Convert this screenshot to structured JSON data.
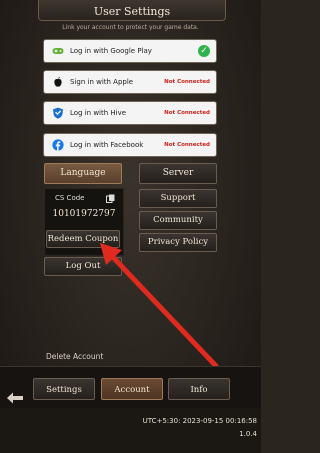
{
  "header": {
    "title": "User Settings",
    "subtitle": "Link your account to protect your game data."
  },
  "login_options": [
    {
      "label": "Log in with Google Play",
      "status": "",
      "icon": "gamepad-icon"
    },
    {
      "label": "Sign in with Apple",
      "status": "Not Connected",
      "icon": "apple-icon"
    },
    {
      "label": "Log in with Hive",
      "status": "Not Connected",
      "icon": "hive-shield-icon"
    },
    {
      "label": "Log in with Facebook",
      "status": "Not Connected",
      "icon": "facebook-icon"
    }
  ],
  "buttons": {
    "language": "Language",
    "server": "Server",
    "support": "Support",
    "community": "Community",
    "privacy_policy": "Privacy Policy",
    "redeem_coupon": "Redeem Coupon",
    "log_out": "Log Out",
    "delete_account": "Delete Account"
  },
  "cs": {
    "label": "CS Code",
    "code": "10101972797"
  },
  "tabs": {
    "settings": "Settings",
    "account": "Account",
    "info": "Info"
  },
  "footer": {
    "timestamp": "UTC+5:30: 2023-09-15 00:16:58",
    "version": "1.0.4"
  },
  "colors": {
    "accent_brown": "#6b4b33",
    "status_red": "#d0201a",
    "connected_green": "#2fb34a",
    "arrow_red": "#e02a20"
  }
}
